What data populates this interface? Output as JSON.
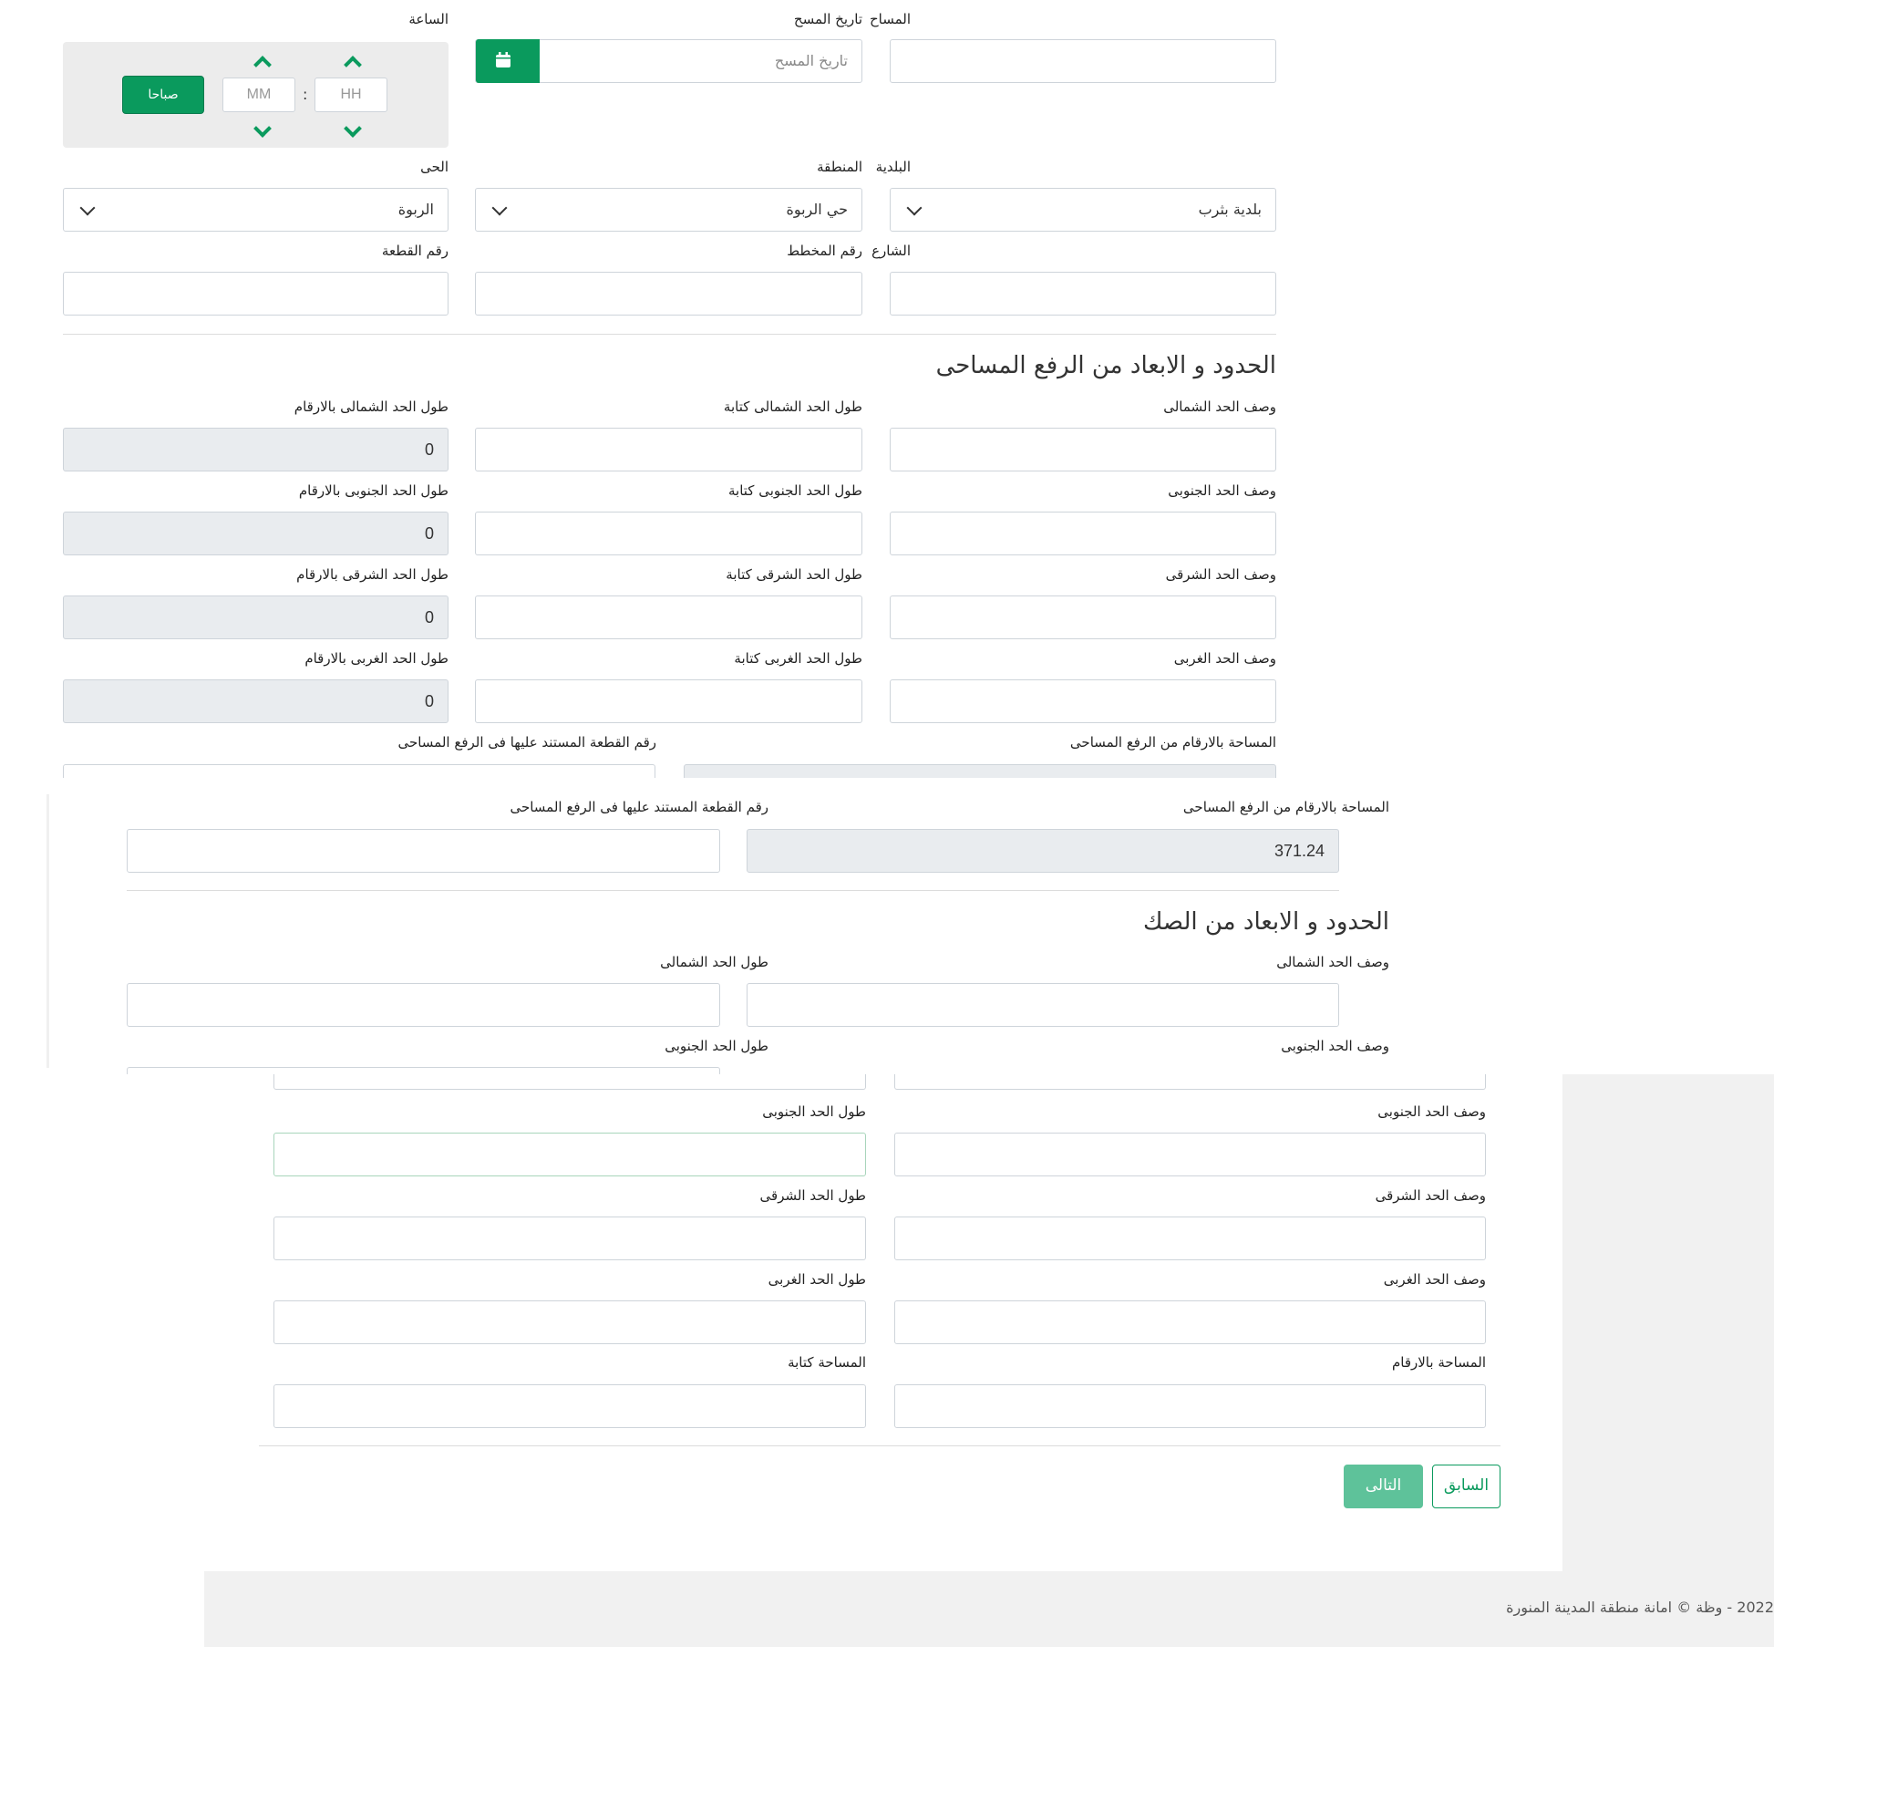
{
  "colors": {
    "accent": "#0a9a5d",
    "readonly_bg": "#e9ecef",
    "footer_bg": "#f1f1f1"
  },
  "top_form": {
    "surveyor_label": "المساح",
    "survey_date_label": "تاريخ المسح",
    "survey_date_placeholder": "تاريخ المسح",
    "calendar_icon": "calendar-icon",
    "time_label": "الساعة",
    "hour_placeholder": "HH",
    "minute_placeholder": "MM",
    "separator": ":",
    "meridian_button": "صباحا",
    "municipality_label": "البلدية",
    "municipality_value": "بلدية بثرب",
    "region_label": "المنطقة",
    "region_value": "حي الربوة",
    "district_label": "الحى",
    "district_value": "الربوة",
    "street_label": "الشارع",
    "plan_number_label": "رقم المخطط",
    "plot_number_label": "رقم القطعة"
  },
  "survey_section": {
    "title": "الحدود و الابعاد من الرفع المساحى",
    "rows": [
      {
        "desc_label": "وصف الحد الشمالى",
        "len_text_label": "طول الحد الشمالى كتابة",
        "len_num_label": "طول الحد الشمالى بالارقام",
        "len_num_value": "0"
      },
      {
        "desc_label": "وصف الحد الجنوبى",
        "len_text_label": "طول الحد الجنوبى كتابة",
        "len_num_label": "طول الحد الجنوبى بالارقام",
        "len_num_value": "0"
      },
      {
        "desc_label": "وصف الحد الشرقى",
        "len_text_label": "طول الحد الشرقى كتابة",
        "len_num_label": "طول الحد الشرقى بالارقام",
        "len_num_value": "0"
      },
      {
        "desc_label": "وصف الحد الغربى",
        "len_text_label": "طول الحد الغربى كتابة",
        "len_num_label": "طول الحد الغربى بالارقام",
        "len_num_value": "0"
      }
    ],
    "area_num_label": "المساحة بالارقام من الرفع المساحى",
    "ref_plot_label": "رقم القطعة المستند عليها فى الرفع المساحى"
  },
  "middle_overlay": {
    "area_num_label": "المساحة بالارقام من الرفع المساحى",
    "area_num_value": "371.24",
    "ref_plot_label": "رقم القطعة المستند عليها فى الرفع المساحى",
    "deed_title": "الحدود و الابعاد من الصك",
    "north_desc_label": "وصف الحد الشمالى",
    "north_len_label": "طول الحد الشمالى",
    "south_desc_label": "وصف الحد الجنوبى",
    "south_len_label": "طول الحد الجنوبى"
  },
  "bottom_panel": {
    "rows": [
      {
        "desc_label": "وصف الحد الجنوبى",
        "len_label": "طول الحد الجنوبى"
      },
      {
        "desc_label": "وصف الحد الشرقى",
        "len_label": "طول الحد الشرقى"
      },
      {
        "desc_label": "وصف الحد الغربى",
        "len_label": "طول الحد الغربى"
      },
      {
        "desc_label": "المساحة بالارقام",
        "len_label": "المساحة كتابة"
      }
    ],
    "prev_button": "السابق",
    "next_button": "التالى"
  },
  "footer": {
    "copyright": "2022 - وظة © امانة منطقة المدينة المنورة"
  }
}
